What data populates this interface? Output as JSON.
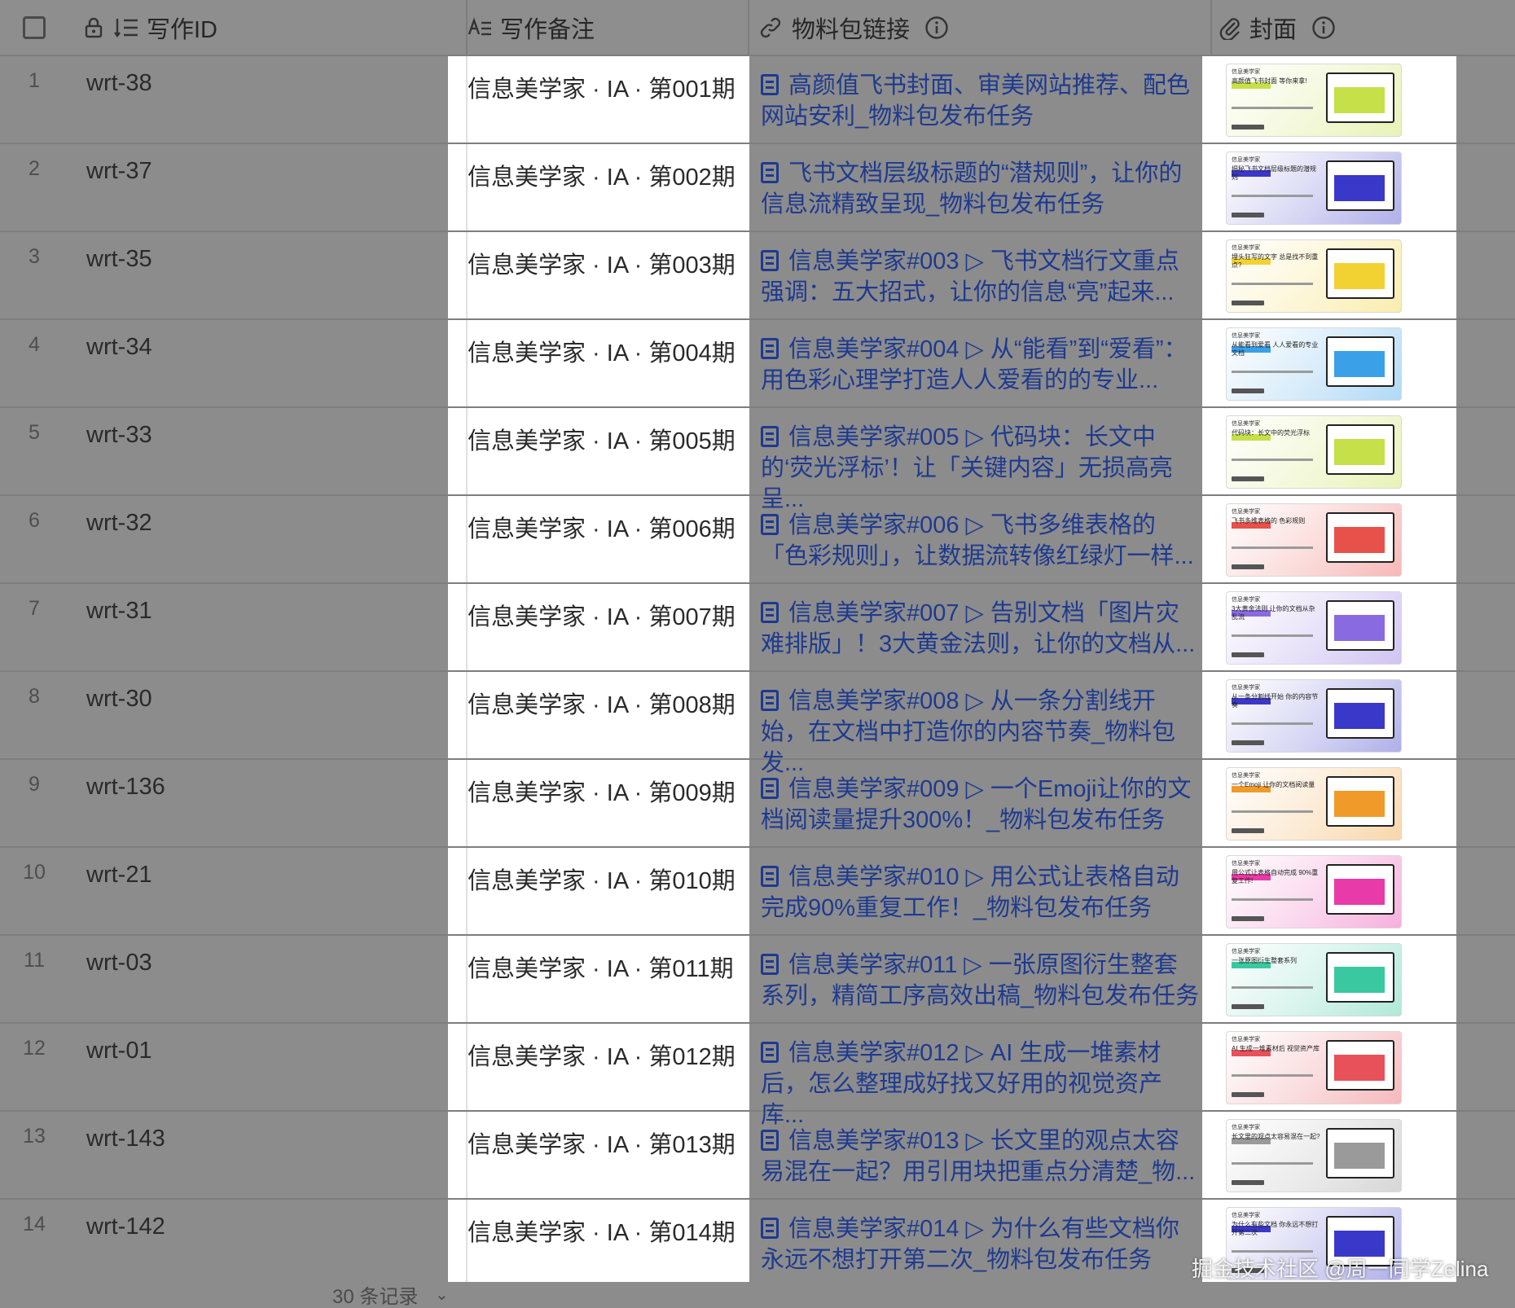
{
  "header": {
    "select_all": "",
    "col_id": "写作ID",
    "col_note": "写作备注",
    "col_link": "物料包链接",
    "col_cover": "封面"
  },
  "rows": [
    {
      "num": "1",
      "id": "wrt-38",
      "note": "信息美学家 · IA · 第001期",
      "link": "高颜值飞书封面、审美网站推荐、配色网站安利_物料包发布任务",
      "cover_title": "高颜值飞书封面 等你来拿!",
      "cover_color": "#c6e04a"
    },
    {
      "num": "2",
      "id": "wrt-37",
      "note": "信息美学家 · IA · 第002期",
      "link": "飞书文档层级标题的“潜规则”，让你的信息流精致呈现_物料包发布任务",
      "cover_title": "揭秘飞书文档层级标题的潜规则",
      "cover_color": "#3a38c8"
    },
    {
      "num": "3",
      "id": "wrt-35",
      "note": "信息美学家 · IA · 第003期",
      "link": "信息美学家#003 ▷ 飞书文档行文重点强调：五大招式，让你的信息“亮”起来...",
      "cover_title": "埋头狂写的文字 总是找不到重点?",
      "cover_color": "#f2d233"
    },
    {
      "num": "4",
      "id": "wrt-34",
      "note": "信息美学家 · IA · 第004期",
      "link": "信息美学家#004 ▷ 从“能看”到“爱看”：用色彩心理学打造人人爱看的的专业...",
      "cover_title": "从能看到爱看 人人爱看的专业文档",
      "cover_color": "#3aa0e8"
    },
    {
      "num": "5",
      "id": "wrt-33",
      "note": "信息美学家 · IA · 第005期",
      "link": "信息美学家#005 ▷ 代码块：长文中的‘荧光浮标’！让「关键内容」无损高亮呈...",
      "cover_title": "代码块：长文中的荧光浮标",
      "cover_color": "#c6e04a"
    },
    {
      "num": "6",
      "id": "wrt-32",
      "note": "信息美学家 · IA · 第006期",
      "link": "信息美学家#006 ▷ 飞书多维表格的「色彩规则」，让数据流转像红绿灯一样...",
      "cover_title": "飞书多维表格的 色彩规则",
      "cover_color": "#e8504a"
    },
    {
      "num": "7",
      "id": "wrt-31",
      "note": "信息美学家 · IA · 第007期",
      "link": "信息美学家#007 ▷ 告别文档「图片灾难排版」！3大黄金法则，让你的文档从...",
      "cover_title": "3大黄金法则 让你的文档从杂乱流",
      "cover_color": "#8a6ae0"
    },
    {
      "num": "8",
      "id": "wrt-30",
      "note": "信息美学家 · IA · 第008期",
      "link": "信息美学家#008 ▷ 从一条分割线开始，在文档中打造你的内容节奏_物料包发...",
      "cover_title": "从一条分割线开始 你的内容节奏",
      "cover_color": "#3a38c8"
    },
    {
      "num": "9",
      "id": "wrt-136",
      "note": "信息美学家 · IA · 第009期",
      "link": "信息美学家#009 ▷ 一个Emoji让你的文档阅读量提升300%！_物料包发布任务",
      "cover_title": "一个Emoji 让你的文档阅读量",
      "cover_color": "#f09a2a"
    },
    {
      "num": "10",
      "id": "wrt-21",
      "note": "信息美学家 · IA · 第010期",
      "link": "信息美学家#010 ▷ 用公式让表格自动完成90%重复工作！_物料包发布任务",
      "cover_title": "用公式让表格自动完成 90%重复工作!",
      "cover_color": "#e83aa8"
    },
    {
      "num": "11",
      "id": "wrt-03",
      "note": "信息美学家 · IA · 第011期",
      "link": "信息美学家#011 ▷ 一张原图衍生整套系列，精简工序高效出稿_物料包发布任务",
      "cover_title": "一张原图衍生整套系列",
      "cover_color": "#3ac8a0"
    },
    {
      "num": "12",
      "id": "wrt-01",
      "note": "信息美学家 · IA · 第012期",
      "link": "信息美学家#012 ▷ AI 生成一堆素材后，怎么整理成好找又好用的视觉资产库...",
      "cover_title": "AI 生成一堆素材后 视觉资产库",
      "cover_color": "#e8505a"
    },
    {
      "num": "13",
      "id": "wrt-143",
      "note": "信息美学家 · IA · 第013期",
      "link": "信息美学家#013 ▷ 长文里的观点太容易混在一起？用引用块把重点分清楚_物...",
      "cover_title": "长文里的观点太容易混在一起?",
      "cover_color": "#9a9a9a"
    },
    {
      "num": "14",
      "id": "wrt-142",
      "note": "信息美学家 · IA · 第014期",
      "link": "信息美学家#014 ▷ 为什么有些文档你永远不想打开第二次_物料包发布任务",
      "cover_title": "为什么有些文档 你永远不想打开第二次",
      "cover_color": "#3a38c8"
    }
  ],
  "cover_brand": "信息美学家",
  "footer": {
    "record_count": "30 条记录",
    "chevron": "⌄"
  },
  "watermark": "掘金技术社区 @周一同学Zelina"
}
